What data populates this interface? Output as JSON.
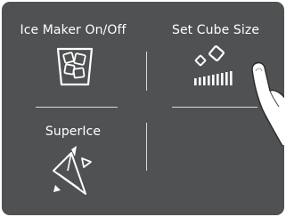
{
  "tiles": {
    "ice_maker": {
      "label": "Ice Maker On/Off",
      "icon": "ice-glass-icon"
    },
    "cube_size": {
      "label": "Set Cube Size",
      "icon": "ice-cubes-size-icon"
    },
    "superice": {
      "label": "SuperIce",
      "icon": "ice-shards-icon"
    },
    "empty": {
      "label": ""
    }
  },
  "pointer": {
    "icon": "finger-pointer-icon"
  },
  "colors": {
    "background": "#4f5152",
    "foreground": "#ffffff",
    "divider": "#d8d8d8"
  }
}
